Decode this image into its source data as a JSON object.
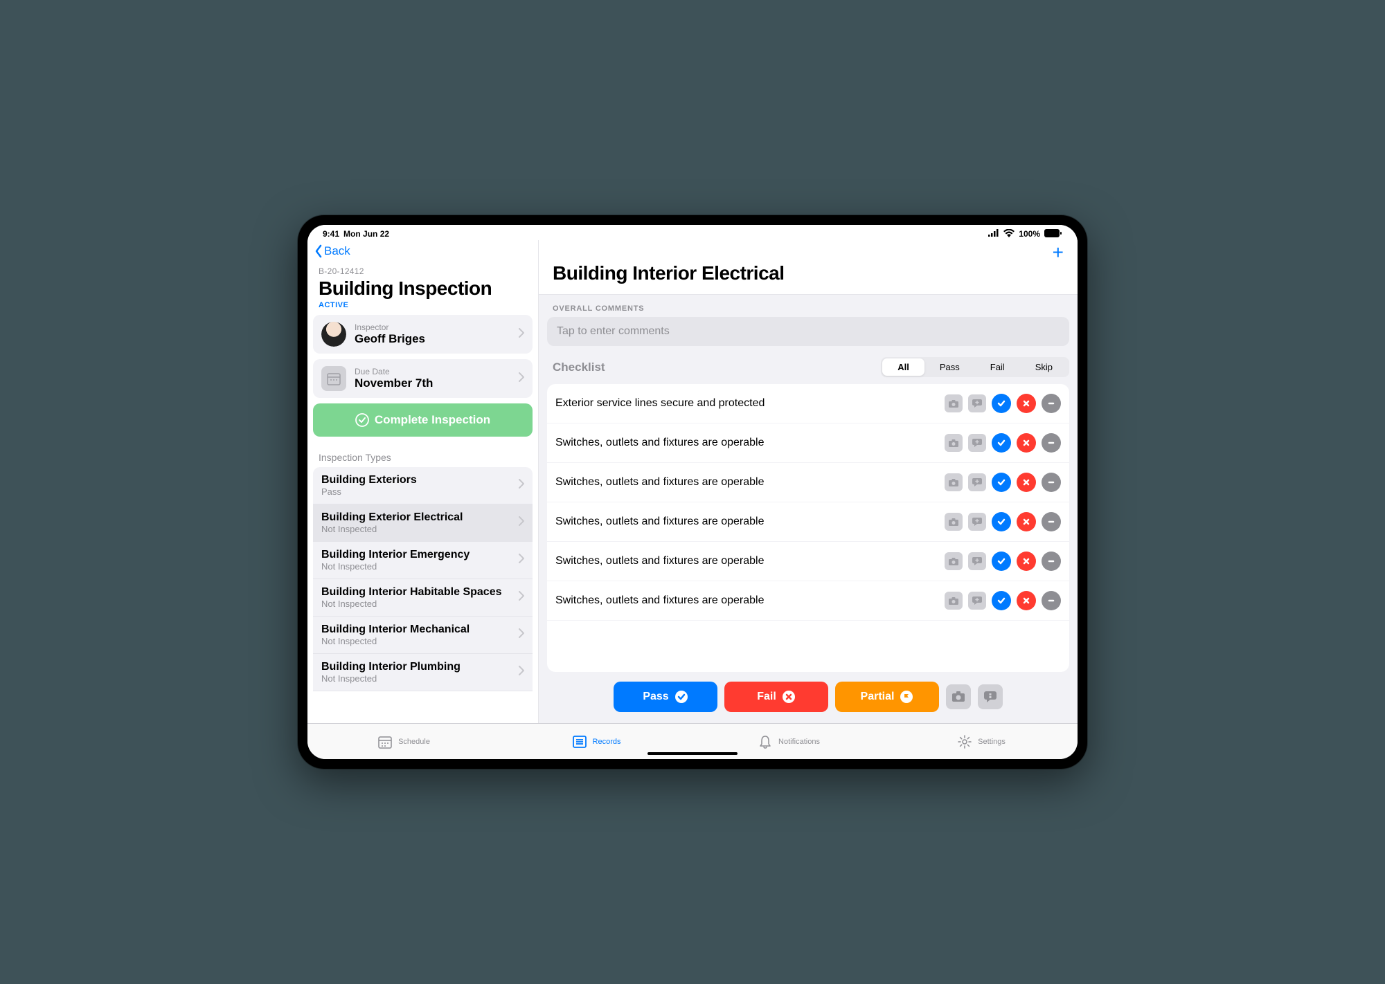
{
  "statusbar": {
    "time": "9:41",
    "date": "Mon Jun 22",
    "battery": "100%"
  },
  "nav": {
    "back": "Back"
  },
  "sidebar": {
    "case_id": "B-20-12412",
    "title": "Building Inspection",
    "status": "ACTIVE",
    "inspector": {
      "label": "Inspector",
      "name": "Geoff Briges"
    },
    "due": {
      "label": "Due Date",
      "value": "November 7th"
    },
    "complete_btn": "Complete Inspection",
    "types_label": "Inspection Types",
    "types": [
      {
        "name": "Building Exteriors",
        "status": "Pass"
      },
      {
        "name": "Building Exterior Electrical",
        "status": "Not Inspected",
        "selected": true
      },
      {
        "name": "Building Interior Emergency",
        "status": "Not Inspected"
      },
      {
        "name": "Building Interior Habitable Spaces",
        "status": "Not Inspected"
      },
      {
        "name": "Building Interior Mechanical",
        "status": "Not Inspected"
      },
      {
        "name": "Building Interior Plumbing",
        "status": "Not Inspected"
      }
    ]
  },
  "main": {
    "title": "Building Interior Electrical",
    "overall_label": "OVERALL COMMENTS",
    "comment_placeholder": "Tap to enter comments",
    "checklist_label": "Checklist",
    "filters": [
      "All",
      "Pass",
      "Fail",
      "Skip"
    ],
    "active_filter": "All",
    "items": [
      "Exterior service lines secure and protected",
      "Switches, outlets and fixtures are operable",
      "Switches, outlets and fixtures are operable",
      "Switches, outlets and fixtures are operable",
      "Switches, outlets and fixtures are operable",
      "Switches, outlets and fixtures are operable"
    ],
    "actions": {
      "pass": "Pass",
      "fail": "Fail",
      "partial": "Partial"
    }
  },
  "tabbar": {
    "tabs": [
      {
        "label": "Schedule"
      },
      {
        "label": "Records",
        "active": true
      },
      {
        "label": "Notifications"
      },
      {
        "label": "Settings"
      }
    ]
  }
}
